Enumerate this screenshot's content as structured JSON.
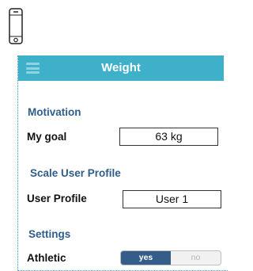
{
  "header": {
    "title": "Weight"
  },
  "sections": {
    "motivation": "Motivation",
    "scale_profile": "Scale User Profile",
    "settings": "Settings"
  },
  "fields": {
    "goal_label": "My goal",
    "goal_value": "63 kg",
    "profile_label": "User Profile",
    "profile_value": "User 1",
    "athletic_label": "Athletic"
  },
  "toggle": {
    "yes": "yes",
    "no": "no",
    "selected": "yes"
  },
  "colors": {
    "header": "#3fb0c9",
    "section": "#2f5e8a",
    "toggle_active": "#355d8a",
    "frame": "#3a9bd6"
  },
  "icons": {
    "device": "phone-icon",
    "menu": "hamburger-icon"
  }
}
